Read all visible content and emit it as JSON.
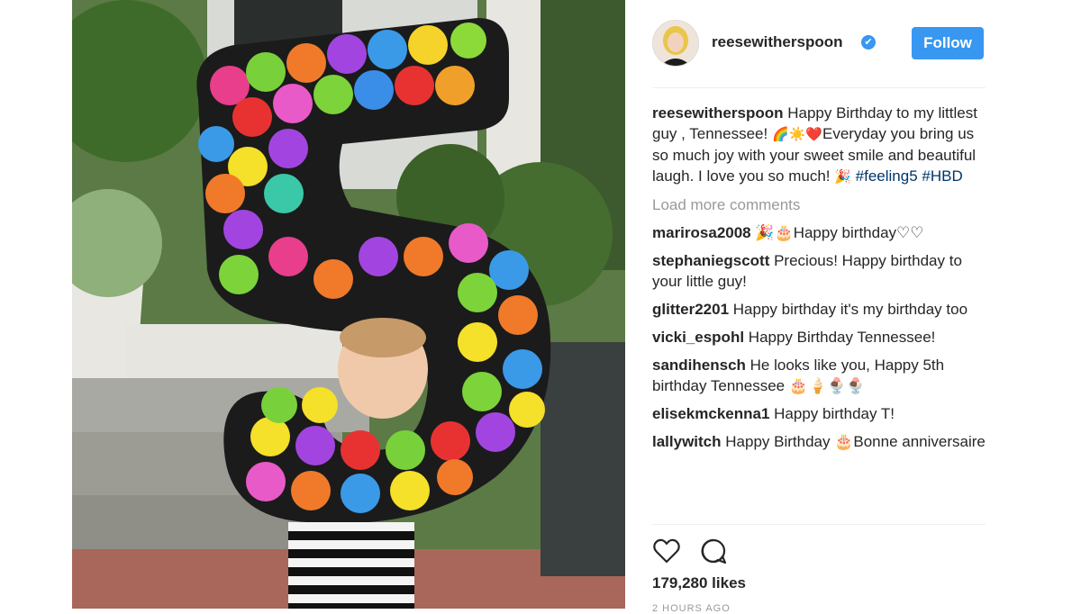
{
  "post": {
    "username": "reesewitherspoon",
    "follow_label": "Follow",
    "verified_icon": "✔",
    "caption": {
      "username": "reesewitherspoon",
      "text_1": " Happy Birthday to my littlest guy , Tennessee! ",
      "emoji_1": "🌈☀️❤️",
      "text_2": "Everyday you bring us so much joy with your sweet smile and beautiful laugh. I love you so much! ",
      "emoji_2": "🎉",
      "hashtag_1": "#feeling5",
      "hashtag_2": "#HBD"
    },
    "load_more_label": "Load more comments",
    "comments": [
      {
        "user": "marirosa2008",
        "text": " 🎉🎂Happy birthday♡♡"
      },
      {
        "user": "stephaniegscott",
        "text": " Precious! Happy birthday to your little guy!"
      },
      {
        "user": "glitter2201",
        "text": " Happy birthday it's my birthday too"
      },
      {
        "user": "vicki_espohl",
        "text": " Happy Birthday Tennessee!"
      },
      {
        "user": "sandihensch",
        "text": " He looks like you, Happy 5th birthday Tennessee 🎂🍦🍨🍨"
      },
      {
        "user": "elisekmckenna1",
        "text": " Happy birthday T!"
      },
      {
        "user": "lallywitch",
        "text": " Happy Birthday 🎂Bonne anniversaire"
      }
    ],
    "likes": "179,280 likes",
    "time_label": "2 HOURS AGO"
  },
  "colors": {
    "accent": "#3897f0",
    "hashtag": "#003569",
    "muted": "#999999"
  },
  "icons": {
    "like": "heart-icon",
    "comment": "comment-icon",
    "verified": "verified-badge-icon"
  }
}
